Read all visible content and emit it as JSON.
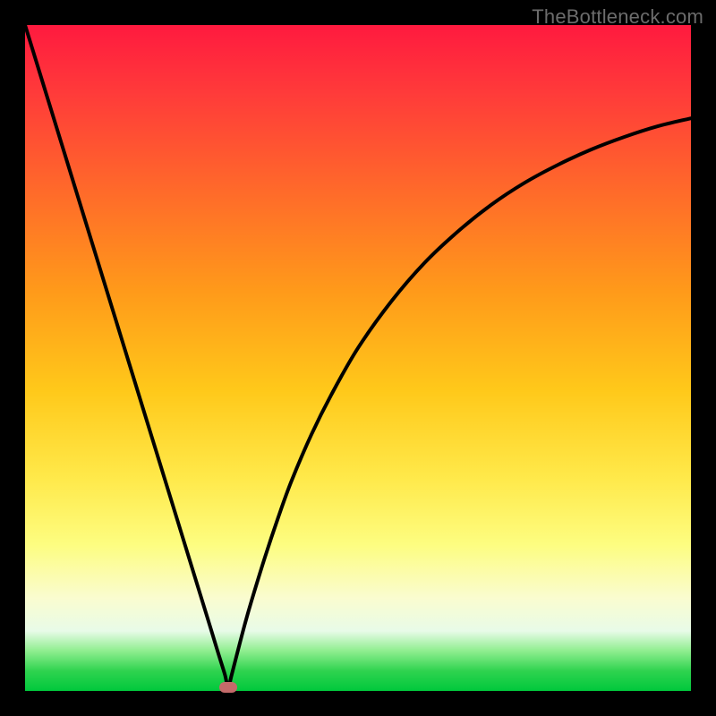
{
  "watermark": "TheBottleneck.com",
  "colors": {
    "frame": "#000000",
    "curve": "#000000",
    "marker": "#c46a6a"
  },
  "chart_data": {
    "type": "line",
    "title": "",
    "xlabel": "",
    "ylabel": "",
    "xlim": [
      0,
      100
    ],
    "ylim": [
      0,
      100
    ],
    "grid": false,
    "legend": false,
    "annotations": [
      {
        "name": "min-marker",
        "x": 30.5,
        "y": 0.5
      }
    ],
    "series": [
      {
        "name": "bottleneck-curve",
        "x": [
          0,
          2,
          4,
          6,
          8,
          10,
          12,
          14,
          16,
          18,
          20,
          22,
          24,
          26,
          28,
          29,
          30,
          30.5,
          31,
          32,
          33,
          34,
          36,
          38,
          40,
          43,
          46,
          50,
          55,
          60,
          65,
          70,
          75,
          80,
          85,
          90,
          95,
          100
        ],
        "y": [
          100,
          93.5,
          87,
          80.5,
          74,
          67.5,
          61,
          54.5,
          48,
          41.5,
          35,
          28.5,
          22,
          15.5,
          9,
          5.7,
          2.5,
          0.5,
          2.3,
          6.2,
          10,
          13.5,
          20,
          26,
          31.5,
          38.5,
          44.5,
          51.5,
          58.5,
          64.3,
          69,
          73,
          76.3,
          79,
          81.3,
          83.2,
          84.8,
          86
        ]
      }
    ]
  }
}
